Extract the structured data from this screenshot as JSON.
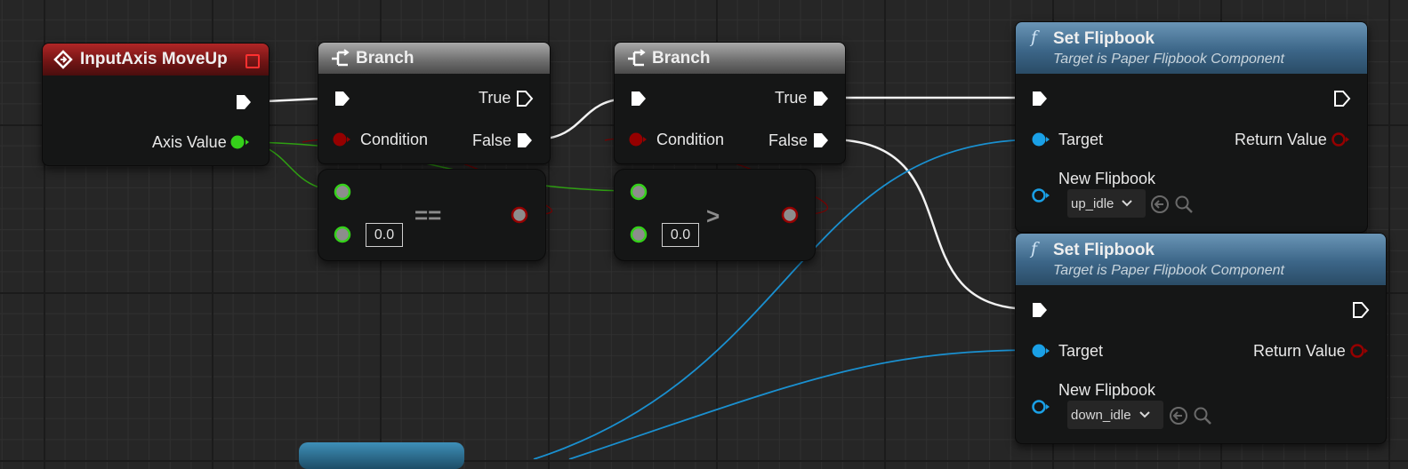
{
  "event_node": {
    "title": "InputAxis MoveUp",
    "axis_value_label": "Axis Value"
  },
  "branch1": {
    "title": "Branch",
    "true_label": "True",
    "false_label": "False",
    "condition_label": "Condition"
  },
  "branch2": {
    "title": "Branch",
    "true_label": "True",
    "false_label": "False",
    "condition_label": "Condition"
  },
  "equal_node": {
    "operator": "==",
    "value": "0.0"
  },
  "greater_node": {
    "operator": ">",
    "value": "0.0"
  },
  "set_flipbook_1": {
    "title": "Set Flipbook",
    "subtitle": "Target is Paper Flipbook Component",
    "target_label": "Target",
    "return_label": "Return Value",
    "new_flipbook_label": "New Flipbook",
    "flipbook_value": "up_idle"
  },
  "set_flipbook_2": {
    "title": "Set Flipbook",
    "subtitle": "Target is Paper Flipbook Component",
    "target_label": "Target",
    "return_label": "Return Value",
    "new_flipbook_label": "New Flipbook",
    "flipbook_value": "down_idle"
  },
  "colors": {
    "exec": "#ffffff",
    "float": "#35d11a",
    "bool": "#950000",
    "object": "#1aa0e6",
    "event_header": "#9a1f1f",
    "func_header": "#4a7696",
    "branch_header": "#8a8a8a"
  }
}
